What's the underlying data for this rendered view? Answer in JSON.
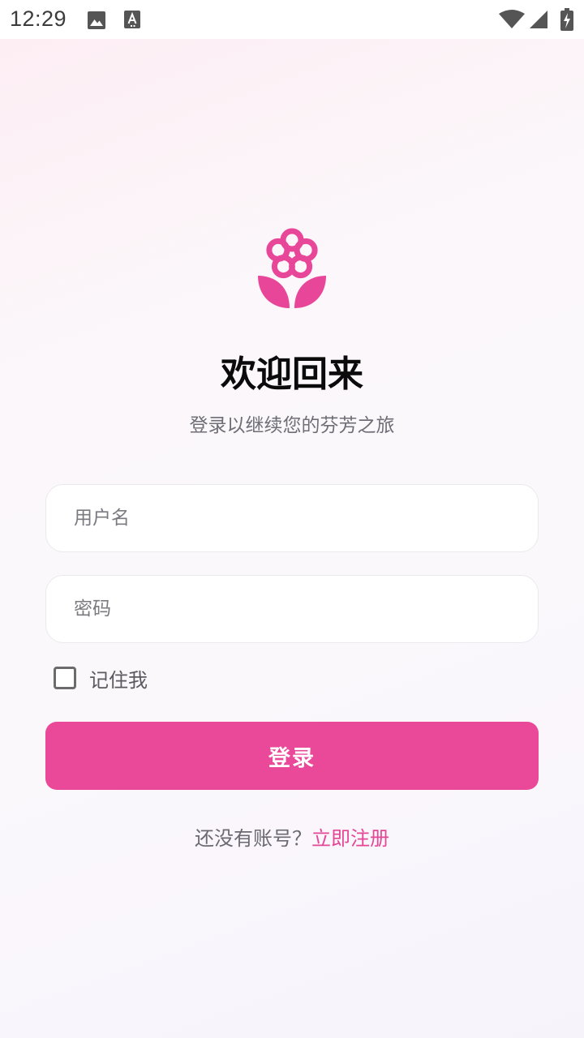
{
  "status_bar": {
    "time": "12:29",
    "left_icons": [
      "image-icon",
      "font-download-icon"
    ],
    "right_icons": [
      "wifi-icon",
      "cellular-signal-icon",
      "battery-charging-icon"
    ]
  },
  "logo": {
    "icon": "flower-icon",
    "color": "#e84799"
  },
  "header": {
    "title": "欢迎回来",
    "subtitle": "登录以继续您的芬芳之旅"
  },
  "form": {
    "username_placeholder": "用户名",
    "password_placeholder": "密码",
    "remember_label": "记住我",
    "remember_checked": false,
    "login_label": "登录"
  },
  "footer": {
    "register_prompt": "还没有账号？",
    "register_link": "立即注册"
  },
  "colors": {
    "accent": "#ea4899",
    "text_primary": "#0b0b0b",
    "text_secondary": "#6e6e76"
  }
}
